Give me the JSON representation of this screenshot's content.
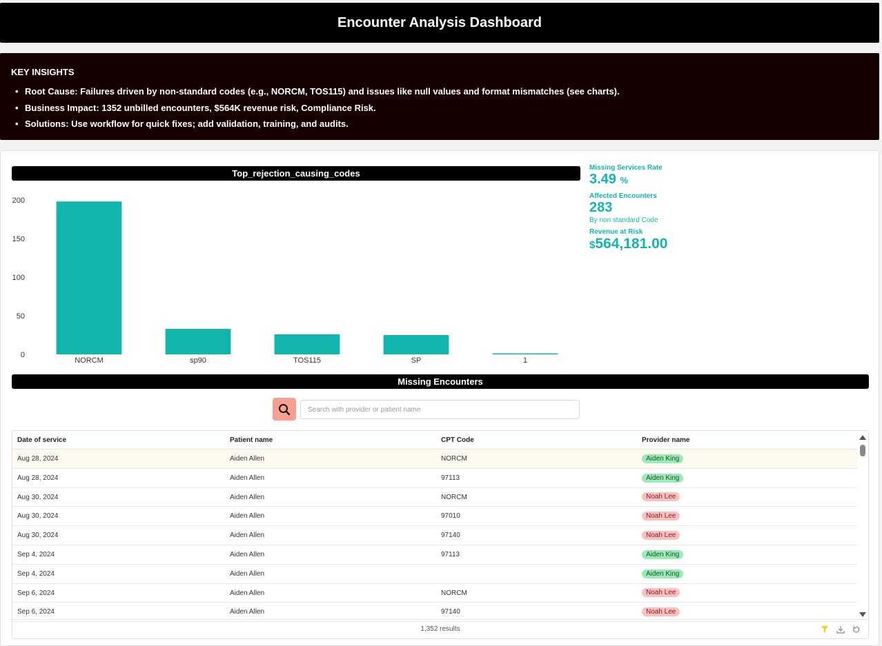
{
  "header": {
    "title": "Encounter Analysis Dashboard"
  },
  "insights": {
    "title": "KEY INSIGHTS",
    "items": [
      "Root Cause: Failures driven by non-standard codes (e.g., NORCM, TOS115) and issues like null values and format mismatches (see charts).",
      "Business Impact: 1352 unbilled encounters, $564K revenue risk, Compliance Risk.",
      "Solutions: Use workflow for quick fixes; add validation, training, and audits."
    ]
  },
  "chart_title": "Top_rejection_causing_codes",
  "chart_data": {
    "type": "bar",
    "categories": [
      "NORCM",
      "sp90",
      "TOS115",
      "SP",
      "1"
    ],
    "values": [
      198,
      33,
      26,
      25,
      1
    ],
    "title": "Top_rejection_causing_codes",
    "ylim": [
      0,
      200
    ],
    "yticks": [
      0,
      50,
      100,
      150,
      200
    ],
    "color": "#12b5ad",
    "grid": false
  },
  "kpis": {
    "missing_rate_label": "Missing Services Rate",
    "missing_rate_value": "3.49",
    "missing_rate_unit": "%",
    "affected_label": "Affected Encounters",
    "affected_value": "283",
    "affected_sub": "By non standard Code",
    "revenue_label": "Revenue at Risk",
    "revenue_currency": "$",
    "revenue_value": "564,181.00"
  },
  "missing_title": "Missing Encounters",
  "search": {
    "placeholder": "Search with provider or patient name",
    "value": ""
  },
  "table": {
    "headers": [
      "Date of service",
      "Patient name",
      "CPT Code",
      "Provider name"
    ],
    "rows": [
      {
        "date": "Aug 28, 2024",
        "patient": "Aiden Allen",
        "cpt": "NORCM",
        "provider": "Aiden King",
        "tone": "green"
      },
      {
        "date": "Aug 28, 2024",
        "patient": "Aiden Allen",
        "cpt": "97113",
        "provider": "Aiden King",
        "tone": "green"
      },
      {
        "date": "Aug 30, 2024",
        "patient": "Aiden Allen",
        "cpt": "NORCM",
        "provider": "Noah Lee",
        "tone": "red"
      },
      {
        "date": "Aug 30, 2024",
        "patient": "Aiden Allen",
        "cpt": "97010",
        "provider": "Noah Lee",
        "tone": "red"
      },
      {
        "date": "Aug 30, 2024",
        "patient": "Aiden Allen",
        "cpt": "97140",
        "provider": "Noah Lee",
        "tone": "red"
      },
      {
        "date": "Sep 4, 2024",
        "patient": "Aiden Allen",
        "cpt": "97113",
        "provider": "Aiden King",
        "tone": "green"
      },
      {
        "date": "Sep 4, 2024",
        "patient": "Aiden Allen",
        "cpt": "",
        "provider": "Aiden King",
        "tone": "green"
      },
      {
        "date": "Sep 6, 2024",
        "patient": "Aiden Allen",
        "cpt": "NORCM",
        "provider": "Noah Lee",
        "tone": "red"
      },
      {
        "date": "Sep 6, 2024",
        "patient": "Aiden Allen",
        "cpt": "97140",
        "provider": "Noah Lee",
        "tone": "red"
      }
    ],
    "results": "1,352 results"
  },
  "colors": {
    "accent": "#12b5ad",
    "search_button": "#f7a090",
    "header_bg": "#000000",
    "insights_bg": "#160000"
  },
  "icons": {
    "search": "search-icon",
    "filter": "filter-icon",
    "download": "download-icon",
    "reset": "reset-icon"
  }
}
